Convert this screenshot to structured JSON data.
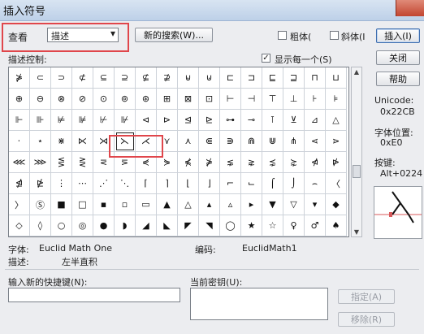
{
  "window": {
    "title": "插入符号"
  },
  "view": {
    "label": "查看",
    "selected": "描述"
  },
  "buttons": {
    "new_search": "新的搜索(W)...",
    "insert": "插入(I)",
    "close": "关闭",
    "help": "帮助",
    "assign": "指定(A)",
    "remove": "移除(R)"
  },
  "options": {
    "bold_label": "粗体(",
    "italic_label": "斜体(I",
    "show_each_label": "显示每一个(S)",
    "show_each_checked": "✓"
  },
  "grid": {
    "header": "描述控制:",
    "rows": [
      [
        "⋡",
        "⊂",
        "⊃",
        "⊄",
        "⊆",
        "⊇",
        "⊈",
        "⊉",
        "⊌",
        "⊍",
        "⊏",
        "⊐",
        "⊑",
        "⊒",
        "⊓",
        "⊔"
      ],
      [
        "⊕",
        "⊖",
        "⊗",
        "⊘",
        "⊙",
        "⊚",
        "⊛",
        "⊞",
        "⊠",
        "⊡",
        "⊢",
        "⊣",
        "⊤",
        "⊥",
        "⊦",
        "⊧"
      ],
      [
        "⊩",
        "⊪",
        "⊭",
        "⊯",
        "⊬",
        "⊮",
        "⊲",
        "⊳",
        "⊴",
        "⊵",
        "⊶",
        "⊸",
        "⊺",
        "⊻",
        "⊿",
        "△"
      ],
      [
        "⋅",
        "⋆",
        "⋇",
        "⋉",
        "⋊",
        "⋋",
        "⋌",
        "⋎",
        "⋏",
        "⋐",
        "⋑",
        "⋒",
        "⋓",
        "⋔",
        "⋖",
        "⋗"
      ],
      [
        "⋘",
        "⋙",
        "⋚",
        "⋛",
        "⋜",
        "⋝",
        "⋞",
        "⋟",
        "⋠",
        "⋡",
        "⋦",
        "⋧",
        "⋨",
        "⋩",
        "⋪",
        "⋫"
      ],
      [
        "⋬",
        "⋭",
        "⋮",
        "⋯",
        "⋰",
        "⋱",
        "⌈",
        "⌉",
        "⌊",
        "⌋",
        "⌐",
        "⌙",
        "⌠",
        "⌡",
        "⌢",
        "〈"
      ],
      [
        "〉",
        "Ⓢ",
        "■",
        "□",
        "▪",
        "▫",
        "▭",
        "▲",
        "△",
        "▴",
        "▵",
        "▸",
        "▼",
        "▽",
        "▾",
        "◆"
      ],
      [
        "◇",
        "◊",
        "○",
        "◎",
        "●",
        "◗",
        "◢",
        "◣",
        "◤",
        "◥",
        "◯",
        "★",
        "☆",
        "♀",
        "♂",
        "♠"
      ]
    ]
  },
  "info": {
    "font_label": "字体:",
    "font_name": "Euclid Math One",
    "encoding_label": "编码:",
    "encoding_value": "EuclidMath1",
    "desc_label": "描述:",
    "desc_value": "左半直积",
    "unicode_label": "Unicode:",
    "unicode_value": "0x22CB",
    "font_pos_label": "字体位置:",
    "font_pos_value": "0xE0",
    "keystroke_label": "按键:",
    "keystroke_value": "Alt+0224"
  },
  "shortcut": {
    "new_label": "输入新的快捷键(N):",
    "current_label": "当前密钥(U):"
  }
}
